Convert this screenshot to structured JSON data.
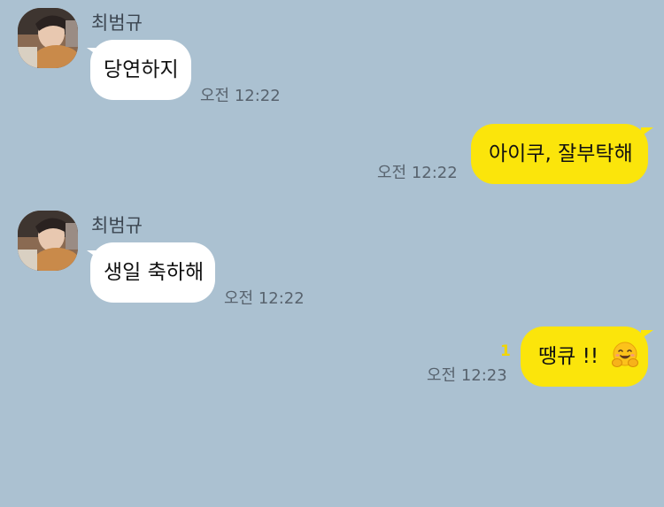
{
  "messages": [
    {
      "type": "in",
      "sender": "최범규",
      "text": "당연하지",
      "time": "오전 12:22"
    },
    {
      "type": "out",
      "text": "아이쿠, 잘부탁해",
      "time": "오전 12:22"
    },
    {
      "type": "in",
      "sender": "최범규",
      "text": "생일 축하해",
      "time": "오전 12:22"
    },
    {
      "type": "out",
      "text": "땡큐 !!",
      "emoji": "hugging-face-emoji",
      "unread": "1",
      "time": "오전 12:23"
    }
  ],
  "colors": {
    "background": "#abc1d1",
    "incoming_bubble": "#ffffff",
    "outgoing_bubble": "#fbe50b",
    "unread_count": "#f1d500"
  }
}
